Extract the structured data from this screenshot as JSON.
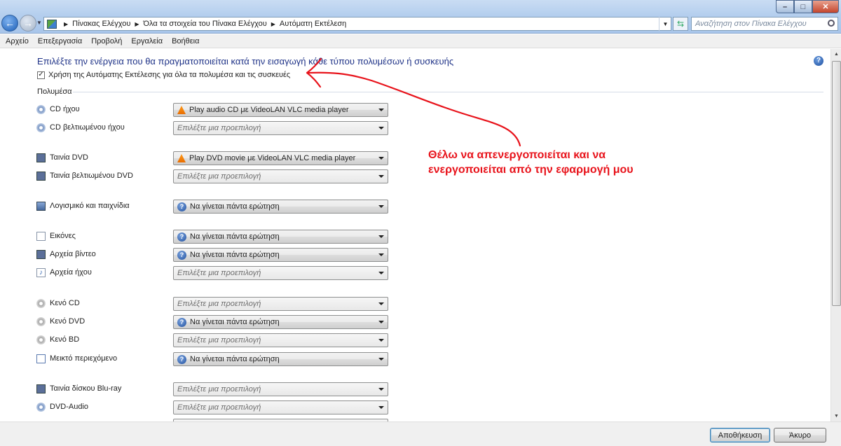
{
  "window": {
    "breadcrumb": [
      "Πίνακας Ελέγχου",
      "Όλα τα στοιχεία του Πίνακα Ελέγχου",
      "Αυτόματη Εκτέλεση"
    ],
    "search_placeholder": "Αναζήτηση στον Πίνακα Ελέγχου"
  },
  "menu": [
    "Αρχείο",
    "Επεξεργασία",
    "Προβολή",
    "Εργαλεία",
    "Βοήθεια"
  ],
  "heading": "Επιλέξτε την ενέργεια που θα πραγματοποιείται κατά την εισαγωγή κάθε τύπου πολυμέσων ή συσκευής",
  "autoplay": {
    "label": "Χρήση της Αυτόματης Εκτέλεσης για όλα τα πολυμέσα και τις συσκευές",
    "checked": true
  },
  "section_label": "Πολυμέσα",
  "rows": [
    {
      "label": "CD ήχου",
      "icon": "disc-icon",
      "value": "Play audio CD με VideoLAN VLC media player",
      "value_icon": "vlc-icon"
    },
    {
      "label": "CD βελτιωμένου ήχου",
      "icon": "disc-icon",
      "value": "Επιλέξτε μια προεπιλογή",
      "value_icon": "none"
    },
    {
      "label": "Ταινία DVD",
      "icon": "film-icon",
      "value": "Play DVD movie με VideoLAN VLC media player",
      "value_icon": "vlc-icon"
    },
    {
      "label": "Ταινία βελτιωμένου DVD",
      "icon": "film-icon",
      "value": "Επιλέξτε μια προεπιλογή",
      "value_icon": "none"
    },
    {
      "label": "Λογισμικό και παιχνίδια",
      "icon": "app-icon",
      "value": "Να γίνεται πάντα ερώτηση",
      "value_icon": "ask-icon"
    },
    {
      "label": "Εικόνες",
      "icon": "document-icon",
      "value": "Να γίνεται πάντα ερώτηση",
      "value_icon": "ask-icon"
    },
    {
      "label": "Αρχεία βίντεο",
      "icon": "film-icon",
      "value": "Να γίνεται πάντα ερώτηση",
      "value_icon": "ask-icon"
    },
    {
      "label": "Αρχεία ήχου",
      "icon": "music-icon",
      "value": "Επιλέξτε μια προεπιλογή",
      "value_icon": "none"
    },
    {
      "label": "Κενό CD",
      "icon": "blank-disc-icon",
      "value": "Επιλέξτε μια προεπιλογή",
      "value_icon": "none"
    },
    {
      "label": "Κενό DVD",
      "icon": "blank-disc-icon",
      "value": "Να γίνεται πάντα ερώτηση",
      "value_icon": "ask-icon"
    },
    {
      "label": "Κενό BD",
      "icon": "blank-disc-icon",
      "value": "Επιλέξτε μια προεπιλογή",
      "value_icon": "none"
    },
    {
      "label": "Μεικτό περιεχόμενο",
      "icon": "mixed-content-icon",
      "value": "Να γίνεται πάντα ερώτηση",
      "value_icon": "ask-icon"
    },
    {
      "label": "Ταινία δίσκου Blu-ray",
      "icon": "film-icon",
      "value": "Επιλέξτε μια προεπιλογή",
      "value_icon": "none"
    },
    {
      "label": "DVD-Audio",
      "icon": "disc-icon",
      "value": "Επιλέξτε μια προεπιλογή",
      "value_icon": "none"
    },
    {
      "label": "",
      "icon": "none",
      "value": "",
      "value_icon": "none"
    }
  ],
  "buttons": {
    "save": "Αποθήκευση",
    "cancel": "Άκυρο"
  },
  "annotation": {
    "lines": [
      "Θέλω να απενεργοποιείται και να",
      "ενεργοποιείται από την εφαρμογή μου"
    ],
    "color": "#e8131b"
  },
  "colors": {
    "heading": "#1e3287",
    "titlebar": "#b5cfee"
  }
}
